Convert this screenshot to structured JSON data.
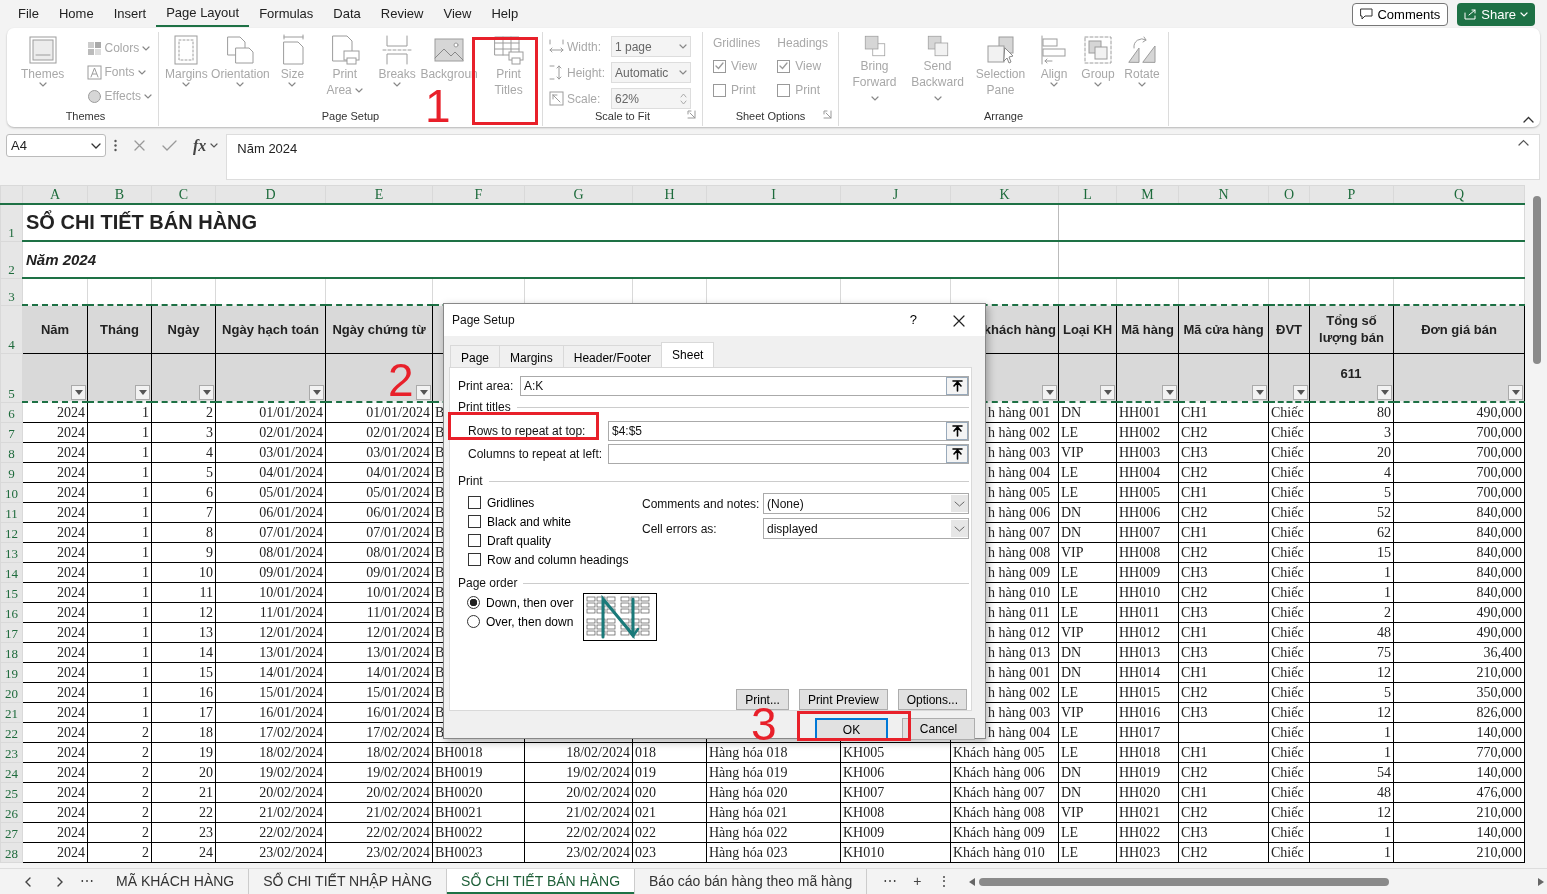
{
  "menu_tabs": [
    {
      "label": "File",
      "selected": false
    },
    {
      "label": "Home",
      "selected": false
    },
    {
      "label": "Insert",
      "selected": false
    },
    {
      "label": "Page Layout",
      "selected": true
    },
    {
      "label": "Formulas",
      "selected": false
    },
    {
      "label": "Data",
      "selected": false
    },
    {
      "label": "Review",
      "selected": false
    },
    {
      "label": "View",
      "selected": false
    },
    {
      "label": "Help",
      "selected": false
    }
  ],
  "top_buttons": {
    "comments": "Comments",
    "share": "Share"
  },
  "ribbon": {
    "disabled": true,
    "groups": [
      {
        "title": "Themes",
        "launcher": false,
        "items": [
          {
            "kind": "large",
            "label": "Themes",
            "caret": true
          },
          {
            "kind": "stack",
            "items": [
              {
                "label": "Colors"
              },
              {
                "label": "Fonts"
              },
              {
                "label": "Effects"
              }
            ]
          }
        ]
      },
      {
        "title": "Page Setup",
        "launcher": false,
        "items": [
          {
            "kind": "large",
            "label": "Margins",
            "caret": true
          },
          {
            "kind": "large",
            "label": "Orientation",
            "caret": true
          },
          {
            "kind": "large",
            "label": "Size",
            "caret": true
          },
          {
            "kind": "large",
            "label": "Print Area",
            "caret": true
          },
          {
            "kind": "large",
            "label": "Breaks",
            "caret": true
          },
          {
            "kind": "large",
            "label": "Backgroun",
            "caret": false
          },
          {
            "kind": "large",
            "label": "Print Titles",
            "caret": false
          }
        ]
      },
      {
        "title": "Scale to Fit",
        "launcher": true,
        "items": [
          {
            "kind": "sizes",
            "rows": [
              {
                "label": "Width:",
                "value": "1 page",
                "kind": "dropdown"
              },
              {
                "label": "Height:",
                "value": "Automatic",
                "kind": "dropdown"
              },
              {
                "label": "Scale:",
                "value": "62%",
                "kind": "spin"
              }
            ]
          }
        ]
      },
      {
        "title": "Sheet Options",
        "launcher": true,
        "items": [
          {
            "kind": "options",
            "label": "Gridlines",
            "options": [
              {
                "label": "View",
                "checked": true
              },
              {
                "label": "Print",
                "checked": false
              }
            ]
          },
          {
            "kind": "options",
            "label": "Headings",
            "options": [
              {
                "label": "View",
                "checked": true
              },
              {
                "label": "Print",
                "checked": false
              }
            ]
          }
        ]
      },
      {
        "title": "Arrange",
        "launcher": false,
        "items": [
          {
            "kind": "large",
            "label": "Bring Forward",
            "caret": true
          },
          {
            "kind": "large",
            "label": "Send Backward",
            "caret": true
          },
          {
            "kind": "large",
            "label": "Selection Pane",
            "caret": false
          },
          {
            "kind": "large",
            "label": "Align",
            "caret": true
          },
          {
            "kind": "large",
            "label": "Group",
            "caret": true
          },
          {
            "kind": "large",
            "label": "Rotate",
            "caret": true
          }
        ]
      }
    ]
  },
  "formula_bar": {
    "name_box": "A4",
    "fx": "fx",
    "content": "Năm 2024"
  },
  "sheet": {
    "columns": [
      "A",
      "B",
      "C",
      "D",
      "E",
      "F",
      "G",
      "H",
      "I",
      "J",
      "K",
      "L",
      "M",
      "N",
      "O",
      "P",
      "Q"
    ],
    "rows": [
      {
        "number": "1",
        "kind": "title",
        "text": "SỔ CHI TIẾT BÁN HÀNG"
      },
      {
        "number": "2",
        "kind": "subtitle",
        "text": "Năm 2024"
      },
      {
        "number": "3",
        "kind": "blank"
      },
      {
        "number": "4",
        "kind": "header",
        "cells": [
          "Năm",
          "Tháng",
          "Ngày",
          "Ngày hạch toán",
          "Ngày chứng từ",
          "khách hàng",
          "Loại KH",
          "Mã hàng",
          "Mã cửa hàng",
          "ĐVT",
          "Tổng số lượng bán",
          "Đơn giá bán"
        ]
      },
      {
        "number": "5",
        "kind": "filter",
        "total": "611"
      },
      {
        "number": "6",
        "kind": "covered",
        "cells": [
          "2024",
          "1",
          "2",
          "01/01/2024",
          "01/01/2024",
          "B",
          "h hàng 001",
          "DN",
          "HH001",
          "CH1",
          "Chiếc",
          "80",
          "490,000"
        ]
      },
      {
        "number": "7",
        "kind": "covered",
        "cells": [
          "2024",
          "1",
          "3",
          "02/01/2024",
          "02/01/2024",
          "B",
          "h hàng 002",
          "LE",
          "HH002",
          "CH2",
          "Chiếc",
          "3",
          "700,000"
        ]
      },
      {
        "number": "8",
        "kind": "covered",
        "cells": [
          "2024",
          "1",
          "4",
          "03/01/2024",
          "03/01/2024",
          "B",
          "h hàng 003",
          "VIP",
          "HH003",
          "CH3",
          "Chiếc",
          "20",
          "700,000"
        ]
      },
      {
        "number": "9",
        "kind": "covered",
        "cells": [
          "2024",
          "1",
          "5",
          "04/01/2024",
          "04/01/2024",
          "B",
          "h hàng 004",
          "LE",
          "HH004",
          "CH2",
          "Chiếc",
          "4",
          "700,000"
        ]
      },
      {
        "number": "10",
        "kind": "covered",
        "cells": [
          "2024",
          "1",
          "6",
          "05/01/2024",
          "05/01/2024",
          "B",
          "h hàng 005",
          "LE",
          "HH005",
          "CH1",
          "Chiếc",
          "5",
          "700,000"
        ]
      },
      {
        "number": "11",
        "kind": "covered",
        "cells": [
          "2024",
          "1",
          "7",
          "06/01/2024",
          "06/01/2024",
          "B",
          "h hàng 006",
          "DN",
          "HH006",
          "CH2",
          "Chiếc",
          "52",
          "840,000"
        ]
      },
      {
        "number": "12",
        "kind": "covered",
        "cells": [
          "2024",
          "1",
          "8",
          "07/01/2024",
          "07/01/2024",
          "B",
          "h hàng 007",
          "DN",
          "HH007",
          "CH1",
          "Chiếc",
          "62",
          "840,000"
        ]
      },
      {
        "number": "13",
        "kind": "covered",
        "cells": [
          "2024",
          "1",
          "9",
          "08/01/2024",
          "08/01/2024",
          "B",
          "h hàng 008",
          "VIP",
          "HH008",
          "CH2",
          "Chiếc",
          "15",
          "840,000"
        ]
      },
      {
        "number": "14",
        "kind": "covered",
        "cells": [
          "2024",
          "1",
          "10",
          "09/01/2024",
          "09/01/2024",
          "B",
          "h hàng 009",
          "LE",
          "HH009",
          "CH3",
          "Chiếc",
          "1",
          "840,000"
        ]
      },
      {
        "number": "15",
        "kind": "covered",
        "cells": [
          "2024",
          "1",
          "11",
          "10/01/2024",
          "10/01/2024",
          "B",
          "h hàng 010",
          "LE",
          "HH010",
          "CH2",
          "Chiếc",
          "1",
          "840,000"
        ]
      },
      {
        "number": "16",
        "kind": "covered",
        "cells": [
          "2024",
          "1",
          "12",
          "11/01/2024",
          "11/01/2024",
          "B",
          "h hàng 011",
          "LE",
          "HH011",
          "CH3",
          "Chiếc",
          "2",
          "490,000"
        ]
      },
      {
        "number": "17",
        "kind": "covered",
        "cells": [
          "2024",
          "1",
          "13",
          "12/01/2024",
          "12/01/2024",
          "B",
          "h hàng 012",
          "VIP",
          "HH012",
          "CH1",
          "Chiếc",
          "48",
          "490,000"
        ]
      },
      {
        "number": "18",
        "kind": "covered",
        "cells": [
          "2024",
          "1",
          "14",
          "13/01/2024",
          "13/01/2024",
          "B",
          "h hàng 013",
          "DN",
          "HH013",
          "CH3",
          "Chiếc",
          "75",
          "36,400"
        ]
      },
      {
        "number": "19",
        "kind": "covered",
        "cells": [
          "2024",
          "1",
          "15",
          "14/01/2024",
          "14/01/2024",
          "B",
          "h hàng 001",
          "DN",
          "HH014",
          "CH1",
          "Chiếc",
          "12",
          "210,000"
        ]
      },
      {
        "number": "20",
        "kind": "covered",
        "cells": [
          "2024",
          "1",
          "16",
          "15/01/2024",
          "15/01/2024",
          "B",
          "h hàng 002",
          "LE",
          "HH015",
          "CH2",
          "Chiếc",
          "5",
          "350,000"
        ]
      },
      {
        "number": "21",
        "kind": "covered",
        "cells": [
          "2024",
          "1",
          "17",
          "16/01/2024",
          "16/01/2024",
          "B",
          "h hàng 003",
          "VIP",
          "HH016",
          "CH3",
          "Chiếc",
          "12",
          "826,000"
        ]
      },
      {
        "number": "22",
        "kind": "covered",
        "cells": [
          "2024",
          "2",
          "18",
          "17/02/2024",
          "17/02/2024",
          "B",
          "h hàng 004",
          "LE",
          "HH017",
          null,
          "Chiếc",
          "1",
          "140,000"
        ]
      },
      {
        "number": "23",
        "kind": "data",
        "cells": [
          "2024",
          "2",
          "19",
          "18/02/2024",
          "18/02/2024",
          "BH0018",
          "18/02/2024",
          "018",
          "Hàng hóa 018",
          "KH005",
          "Khách hàng 005",
          "LE",
          "HH018",
          "CH1",
          "Chiếc",
          "1",
          "770,000"
        ]
      },
      {
        "number": "24",
        "kind": "data",
        "cells": [
          "2024",
          "2",
          "20",
          "19/02/2024",
          "19/02/2024",
          "BH0019",
          "19/02/2024",
          "019",
          "Hàng hóa 019",
          "KH006",
          "Khách hàng 006",
          "DN",
          "HH019",
          "CH2",
          "Chiếc",
          "54",
          "140,000"
        ]
      },
      {
        "number": "25",
        "kind": "data",
        "cells": [
          "2024",
          "2",
          "21",
          "20/02/2024",
          "20/02/2024",
          "BH0020",
          "20/02/2024",
          "020",
          "Hàng hóa 020",
          "KH007",
          "Khách hàng 007",
          "DN",
          "HH020",
          "CH1",
          "Chiếc",
          "48",
          "476,000"
        ]
      },
      {
        "number": "26",
        "kind": "data",
        "cells": [
          "2024",
          "2",
          "22",
          "21/02/2024",
          "21/02/2024",
          "BH0021",
          "21/02/2024",
          "021",
          "Hàng hóa 021",
          "KH008",
          "Khách hàng 008",
          "VIP",
          "HH021",
          "CH2",
          "Chiếc",
          "12",
          "210,000"
        ]
      },
      {
        "number": "27",
        "kind": "data",
        "cells": [
          "2024",
          "2",
          "23",
          "22/02/2024",
          "22/02/2024",
          "BH0022",
          "22/02/2024",
          "022",
          "Hàng hóa 022",
          "KH009",
          "Khách hàng 009",
          "LE",
          "HH022",
          "CH3",
          "Chiếc",
          "1",
          "140,000"
        ]
      },
      {
        "number": "28",
        "kind": "data",
        "cells": [
          "2024",
          "2",
          "24",
          "23/02/2024",
          "23/02/2024",
          "BH0023",
          "23/02/2024",
          "023",
          "Hàng hóa 023",
          "KH010",
          "Khách hàng 010",
          "LE",
          "HH023",
          "CH2",
          "Chiếc",
          "1",
          "210,000"
        ]
      }
    ]
  },
  "sheet_tabs": {
    "more_left": "⋯",
    "tabs": [
      {
        "label": "MÃ KHÁCH HÀNG",
        "selected": false
      },
      {
        "label": "SỔ CHI TIẾT NHẬP HÀNG",
        "selected": false
      },
      {
        "label": "SỔ CHI TIẾT BÁN HÀNG",
        "selected": true
      },
      {
        "label": "Báo cáo bán hàng theo mã hàng",
        "selected": false
      }
    ],
    "more_right": "⋯",
    "add": "+",
    "options": "⋮"
  },
  "dialog": {
    "title": "Page Setup",
    "help": "?",
    "tabs": [
      {
        "label": "Page",
        "selected": false
      },
      {
        "label": "Margins",
        "selected": false
      },
      {
        "label": "Header/Footer",
        "selected": false
      },
      {
        "label": "Sheet",
        "selected": true
      }
    ],
    "print_area": {
      "label": "Print area:",
      "value": "A:K"
    },
    "print_titles": {
      "heading": "Print titles",
      "rows": {
        "label": "Rows to repeat at top:",
        "value": "$4:$5"
      },
      "columns": {
        "label": "Columns to repeat at left:"
      }
    },
    "print": {
      "heading": "Print",
      "options": [
        {
          "label": "Gridlines",
          "checked": false
        },
        {
          "label": "Black and white",
          "checked": false
        },
        {
          "label": "Draft quality",
          "checked": false
        },
        {
          "label": "Row and column headings",
          "checked": false
        }
      ],
      "selects": [
        {
          "label": "Comments and notes:",
          "value": "(None)"
        },
        {
          "label": "Cell errors as:",
          "value": "displayed"
        }
      ]
    },
    "page_order": {
      "heading": "Page order",
      "options": [
        {
          "label": "Down, then over",
          "selected": true
        },
        {
          "label": "Over, then down",
          "selected": false
        }
      ]
    },
    "buttons": [
      "Print...",
      "Print Preview",
      "Options..."
    ],
    "footer_buttons": [
      {
        "label": "OK",
        "default": true
      },
      {
        "label": "Cancel",
        "default": false
      }
    ]
  },
  "annotations": [
    {
      "label": "1"
    },
    {
      "label": "2"
    },
    {
      "label": "3"
    }
  ]
}
